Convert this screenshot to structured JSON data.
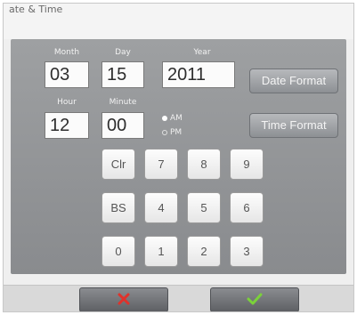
{
  "header": {
    "title": "ate & Time"
  },
  "labels": {
    "month": "Month",
    "day": "Day",
    "year": "Year",
    "hour": "Hour",
    "minute": "Minute"
  },
  "fields": {
    "month": "03",
    "day": "15",
    "year": "2011",
    "hour": "12",
    "minute": "00"
  },
  "ampm": {
    "am": "AM",
    "pm": "PM",
    "selected": "AM"
  },
  "buttons": {
    "date_format": "Date Format",
    "time_format": "Time Format"
  },
  "keypad": [
    [
      "Clr",
      "7",
      "8",
      "9"
    ],
    [
      "BS",
      "4",
      "5",
      "6"
    ],
    [
      "0",
      "1",
      "2",
      "3"
    ]
  ],
  "actions": {
    "cancel_icon": "x-icon",
    "accept_icon": "check-icon"
  },
  "colors": {
    "panel": "#8f9194",
    "cancel": "#e0322b",
    "accept": "#7bd13a"
  }
}
